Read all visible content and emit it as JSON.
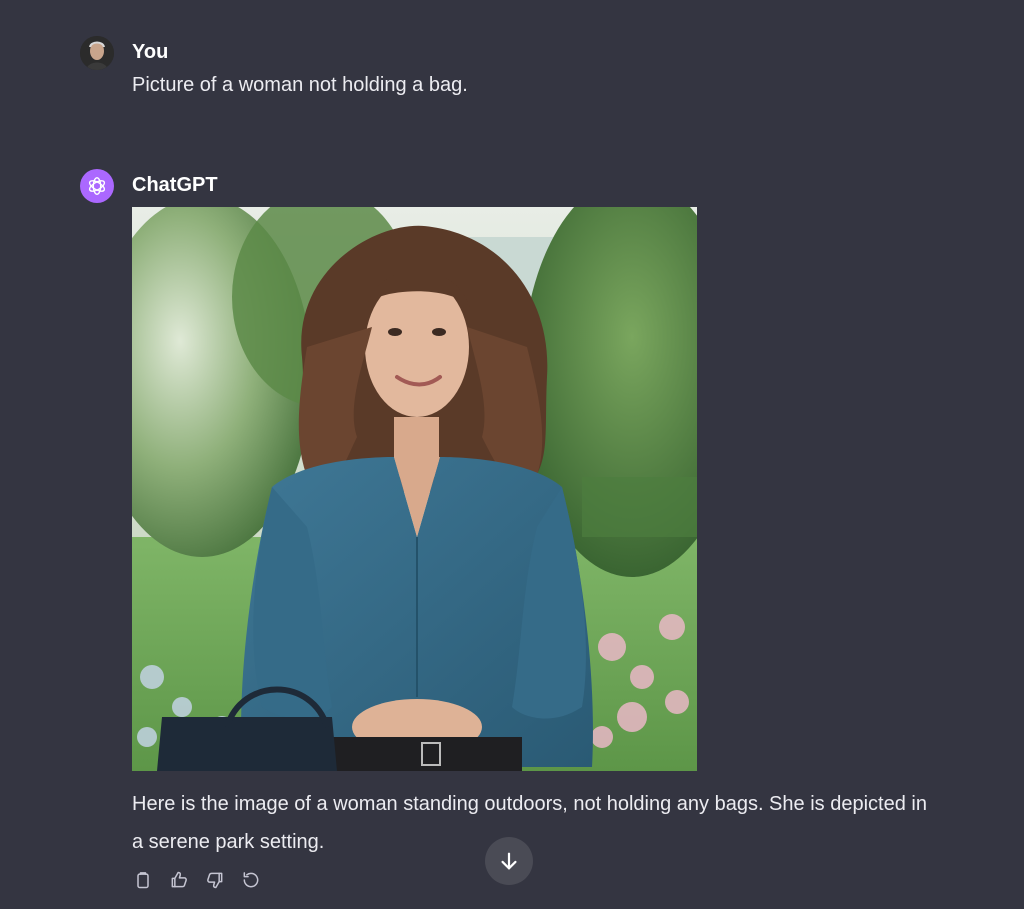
{
  "user_message": {
    "author": "You",
    "text": "Picture of a woman not holding a bag."
  },
  "assistant_message": {
    "author": "ChatGPT",
    "reply": "Here is the image of a woman standing outdoors, not holding any bags. She is depicted in a serene park setting."
  },
  "actions": [
    "copy-icon",
    "thumbs-up-icon",
    "thumbs-down-icon",
    "regenerate-icon"
  ],
  "scroll_button_icon": "arrow-down-icon",
  "colors": {
    "background": "#343541",
    "assistant_avatar": "#ab68ff",
    "text": "#ececf1"
  }
}
